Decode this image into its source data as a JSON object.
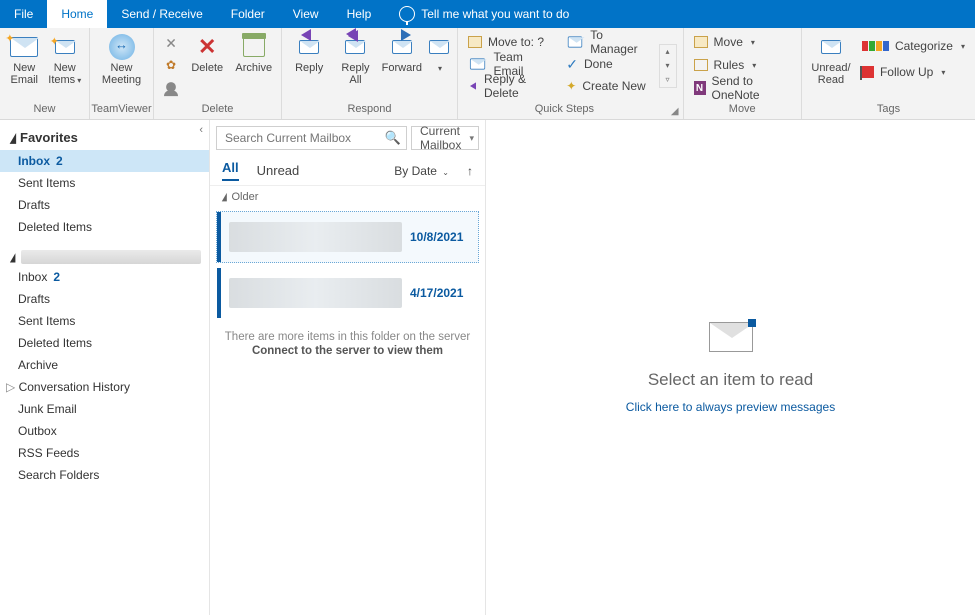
{
  "tabs": {
    "file": "File",
    "home": "Home",
    "send": "Send / Receive",
    "folder": "Folder",
    "view": "View",
    "help": "Help",
    "tell": "Tell me what you want to do"
  },
  "ribbon": {
    "new": {
      "email": "New\nEmail",
      "items": "New\nItems",
      "label": "New"
    },
    "teamviewer": {
      "meeting": "New\nMeeting",
      "label": "TeamViewer"
    },
    "delete": {
      "delete": "Delete",
      "archive": "Archive",
      "label": "Delete"
    },
    "respond": {
      "reply": "Reply",
      "replyall": "Reply\nAll",
      "forward": "Forward",
      "label": "Respond"
    },
    "quicksteps": {
      "moveto": "Move to: ?",
      "team": "Team Email",
      "replydel": "Reply & Delete",
      "tomgr": "To Manager",
      "done": "Done",
      "create": "Create New",
      "label": "Quick Steps"
    },
    "move": {
      "move": "Move",
      "rules": "Rules",
      "onenote": "Send to OneNote",
      "label": "Move"
    },
    "tags": {
      "unread": "Unread/\nRead",
      "categorize": "Categorize",
      "followup": "Follow Up",
      "label": "Tags"
    }
  },
  "nav": {
    "favorites": "Favorites",
    "fav_items": [
      {
        "label": "Inbox",
        "count": "2",
        "selected": true
      },
      {
        "label": "Sent Items"
      },
      {
        "label": "Drafts"
      },
      {
        "label": "Deleted Items"
      }
    ],
    "tree": [
      {
        "label": "Inbox",
        "count": "2"
      },
      {
        "label": "Drafts"
      },
      {
        "label": "Sent Items"
      },
      {
        "label": "Deleted Items"
      },
      {
        "label": "Archive"
      },
      {
        "label": "Conversation History",
        "expander": true
      },
      {
        "label": "Junk Email"
      },
      {
        "label": "Outbox"
      },
      {
        "label": "RSS Feeds"
      },
      {
        "label": "Search Folders"
      }
    ]
  },
  "list": {
    "search_placeholder": "Search Current Mailbox",
    "scope": "Current Mailbox",
    "filter_all": "All",
    "filter_unread": "Unread",
    "sort": "By Date",
    "group_older": "Older",
    "messages": [
      {
        "date": "10/8/2021",
        "selected": true
      },
      {
        "date": "4/17/2021"
      }
    ],
    "more1": "There are more items in this folder on the server",
    "more2": "Connect to the server to view them"
  },
  "read": {
    "title": "Select an item to read",
    "link": "Click here to always preview messages"
  }
}
